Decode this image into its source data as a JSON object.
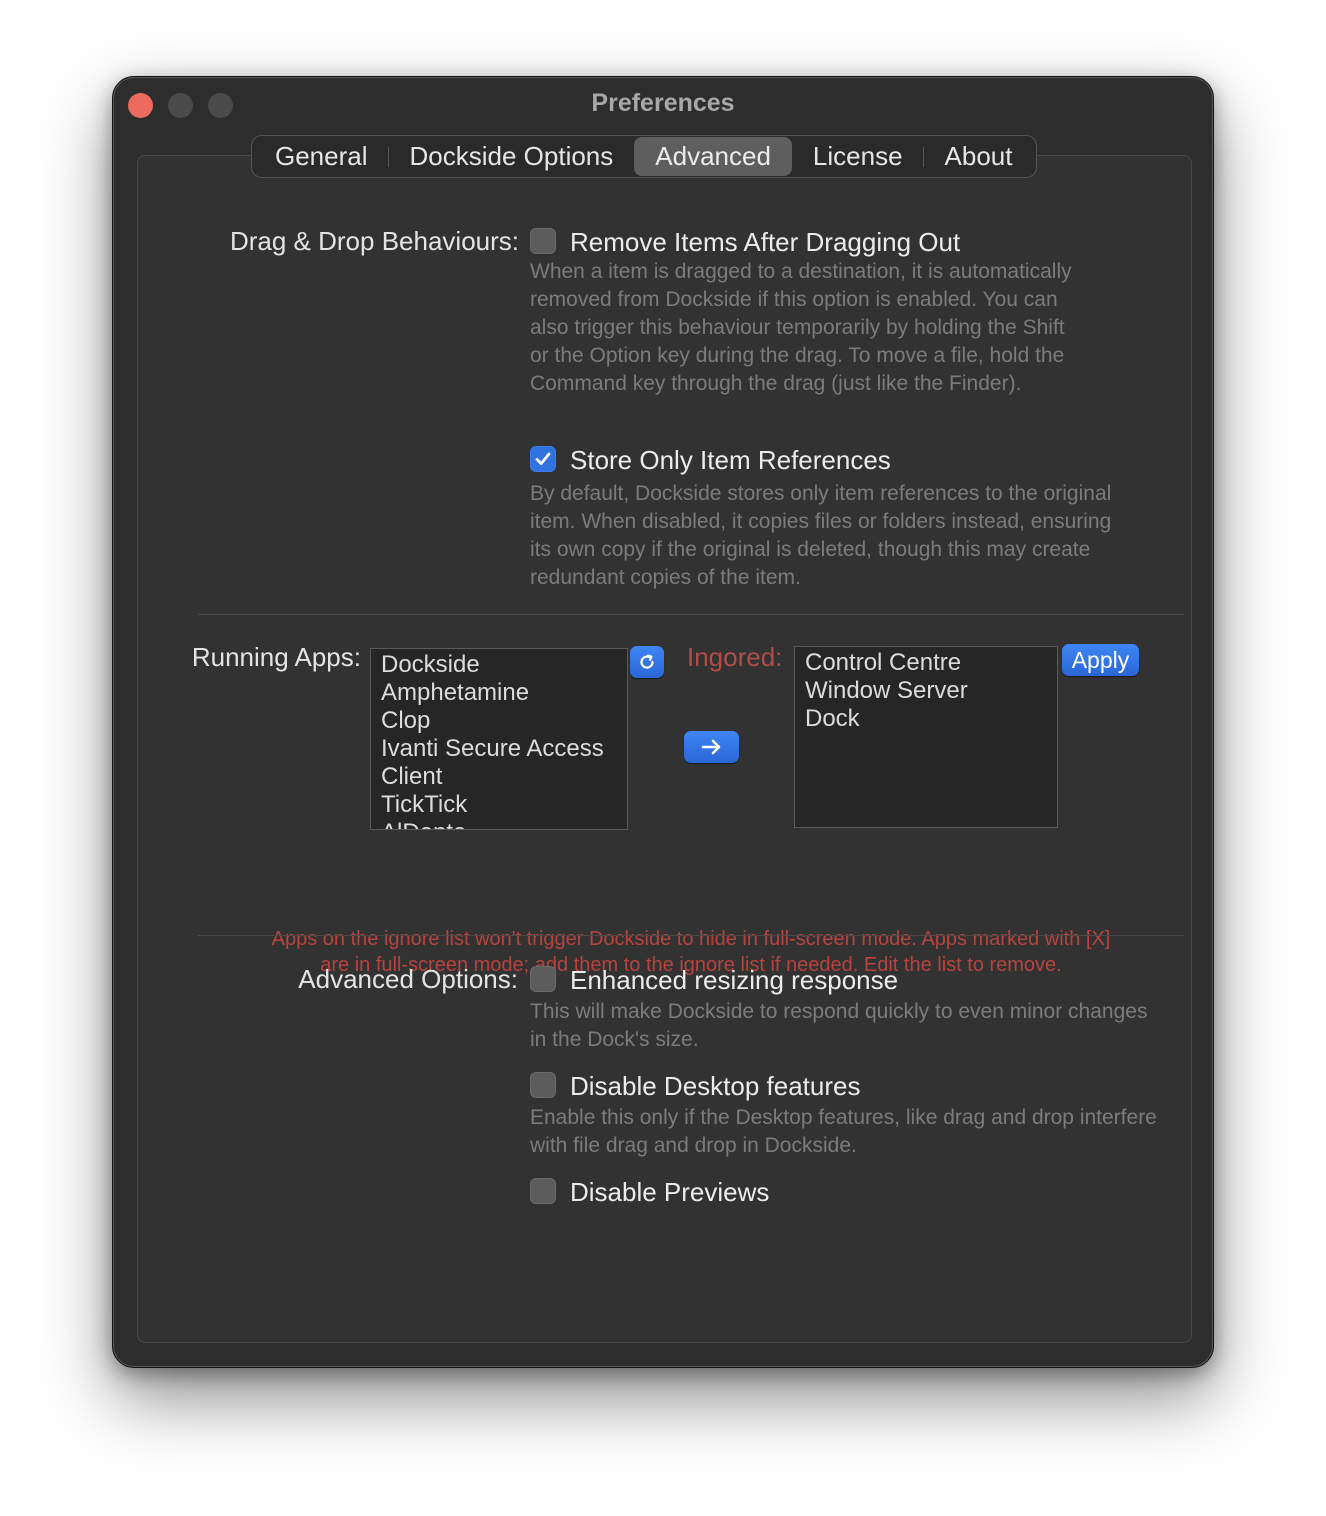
{
  "window": {
    "title": "Preferences"
  },
  "tabs": [
    {
      "label": "General"
    },
    {
      "label": "Dockside Options"
    },
    {
      "label": "Advanced"
    },
    {
      "label": "License"
    },
    {
      "label": "About"
    }
  ],
  "active_tab": "Advanced",
  "drag_drop": {
    "label": "Drag & Drop Behaviours:",
    "remove_items": {
      "label": "Remove Items After Dragging Out",
      "checked": false,
      "description": "When a item is dragged to a destination, it is automatically removed from Dockside if this option is enabled. You can also trigger this behaviour temporarily by holding the Shift or the Option key during the drag. To move a file, hold the Command key through the drag (just like the Finder)."
    },
    "store_refs": {
      "label": "Store Only Item References",
      "checked": true,
      "description": "By default, Dockside stores only item references to the original item. When disabled, it copies files or folders instead, ensuring its own copy if the original is deleted, though this may create redundant copies of the item."
    }
  },
  "running_apps": {
    "label": "Running Apps:",
    "items": [
      "Dockside",
      "Amphetamine",
      "Clop",
      "Ivanti Secure Access",
      "Client",
      "TickTick",
      "AlDente"
    ],
    "refresh_icon": "refresh-icon",
    "move_icon": "arrow-right-icon"
  },
  "ignored": {
    "label": "Ingored:",
    "items": [
      "Control Centre",
      "Window Server",
      "Dock"
    ],
    "apply_label": "Apply"
  },
  "warning": "Apps on the ignore list won't trigger Dockside to hide in full-screen mode. Apps marked with [X] are in full-screen mode; add them to the ignore list if needed. Edit the list to remove.",
  "advanced": {
    "label": "Advanced Options:",
    "enhanced_resizing": {
      "label": "Enhanced resizing response",
      "checked": false,
      "description": "This will make Dockside to respond quickly to even minor changes in the Dock's size."
    },
    "disable_desktop": {
      "label": "Disable Desktop features",
      "checked": false,
      "description": "Enable this only if the Desktop features, like drag and drop interfere with file drag and drop in Dockside."
    },
    "disable_previews": {
      "label": "Disable Previews",
      "checked": false
    }
  },
  "colors": {
    "accent": "#2f72e0",
    "warning": "#b8433f",
    "close_button": "#ec6a5e"
  }
}
